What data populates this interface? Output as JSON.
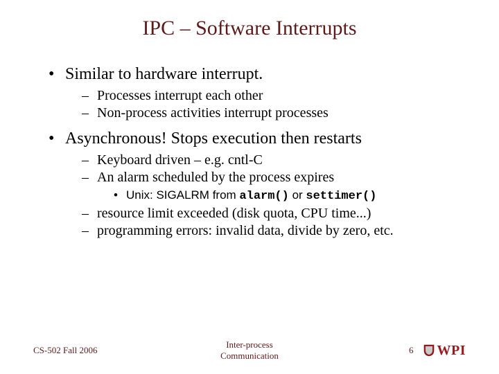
{
  "title": "IPC – Software Interrupts",
  "bullets": [
    {
      "text": "Similar to hardware interrupt.",
      "sub": [
        {
          "text": "Processes interrupt each other"
        },
        {
          "text": "Non-process activities interrupt processes"
        }
      ]
    },
    {
      "text": "Asynchronous! Stops execution then restarts",
      "sub": [
        {
          "text": "Keyboard driven – e.g. cntl-C"
        },
        {
          "text": "An alarm scheduled by the process expires",
          "sub3": {
            "prefix": "Unix: SIGALRM from ",
            "code1": "alarm()",
            "mid": " or ",
            "code2": "settimer()"
          }
        },
        {
          "text": "resource limit exceeded (disk quota, CPU time...)"
        },
        {
          "text": "programming errors: invalid data, divide by zero, etc."
        }
      ]
    }
  ],
  "footer": {
    "left": "CS-502 Fall 2006",
    "center_line1": "Inter-process",
    "center_line2": "Communication",
    "page": "6",
    "logo_text": "WPI"
  }
}
